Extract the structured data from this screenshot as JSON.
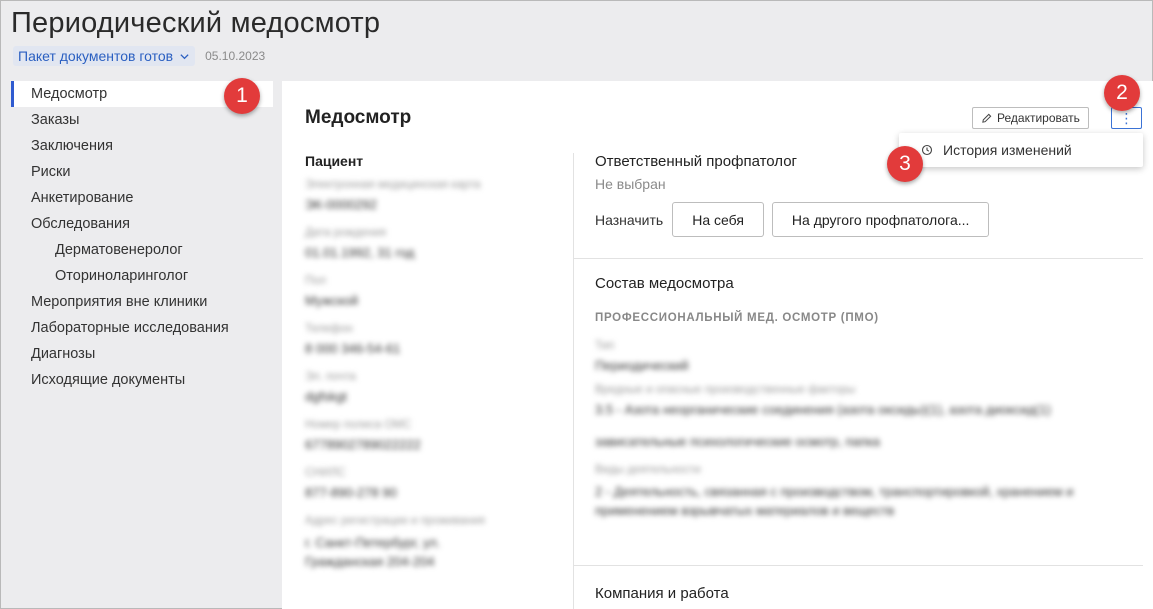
{
  "header": {
    "title": "Периодический медосмотр",
    "status_label": "Пакет документов готов",
    "date": "05.10.2023"
  },
  "sidebar": {
    "items": [
      {
        "label": "Медосмотр"
      },
      {
        "label": "Заказы"
      },
      {
        "label": "Заключения"
      },
      {
        "label": "Риски"
      },
      {
        "label": "Анкетирование"
      },
      {
        "label": "Обследования"
      },
      {
        "label": "Дерматовенеролог"
      },
      {
        "label": "Оториноларинголог"
      },
      {
        "label": "Мероприятия вне клиники"
      },
      {
        "label": "Лабораторные исследования"
      },
      {
        "label": "Диагнозы"
      },
      {
        "label": "Исходящие документы"
      }
    ]
  },
  "main": {
    "title": "Медосмотр",
    "edit_label": "Редактировать",
    "more_label": "⋮",
    "menu": {
      "history_label": "История изменений"
    },
    "patient": {
      "title": "Пациент",
      "fields": [
        {
          "label": "Электронная медицинская карта",
          "value": "ЭК-0000292"
        },
        {
          "label": "Дата рождения",
          "value": "01.01.1992, 31 год"
        },
        {
          "label": "Пол",
          "value": "Мужской"
        },
        {
          "label": "Телефон",
          "value": "8 000 346-54-61"
        },
        {
          "label": "Эл. почта",
          "value": "dgfskgt"
        },
        {
          "label": "Номер полиса ОМС",
          "value": "6778902789022222"
        },
        {
          "label": "СНИЛС",
          "value": "877-890-278 90"
        },
        {
          "label": "Адрес регистрации и проживания",
          "value": "г. Санкт-Петербург, ул. Гражданская 204-204"
        }
      ]
    },
    "responsible": {
      "title": "Ответственный профпатолог",
      "value": "Не выбран",
      "assign_label": "Назначить",
      "self_button": "На себя",
      "other_button": "На другого профпатолога..."
    },
    "composition": {
      "title": "Состав медосмотра",
      "subtitle": "ПРОФЕССИОНАЛЬНЫЙ МЕД. ОСМОТР (ПМО)",
      "type_label": "Тип",
      "type_value": "Периодический",
      "factors_label": "Вредные и опасные производственные факторы",
      "factors_value1": "3.5 - Азота неорганические соединения (азота оксиды)(1), азота диоксид(1)",
      "factors_value2": "зависательные психологические осмотр, папка",
      "work_label": "Виды деятельности",
      "work_value": "2 - Деятельность, связанная с производством, транспортировкой, хранением и применением взрывчатых материалов и веществ"
    },
    "company": {
      "title": "Компания и работа"
    }
  },
  "markers": [
    "1",
    "2",
    "3"
  ],
  "colors": {
    "accent": "#2f5bd0",
    "marker": "#e23b3b",
    "status_bg": "#e1e6f1"
  }
}
